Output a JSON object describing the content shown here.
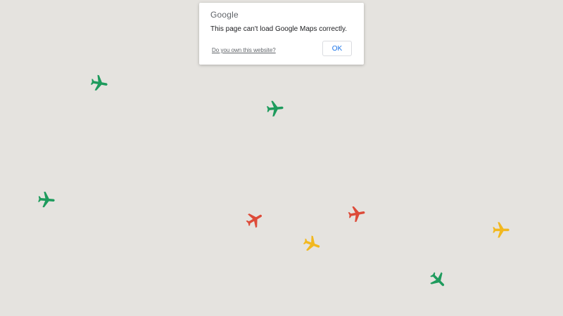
{
  "dialog": {
    "logo_text": "Google",
    "message": "This page can't load Google Maps correctly.",
    "own_link": "Do you own this website?",
    "ok_label": "OK"
  },
  "colors": {
    "map_background": "#e5e3df",
    "green": "#1e9b5d",
    "red": "#dd4b39",
    "yellow": "#f2b81f"
  },
  "markers": [
    {
      "icon": "airplane-icon",
      "color": "green"
    },
    {
      "icon": "airplane-icon",
      "color": "green"
    },
    {
      "icon": "airplane-icon",
      "color": "green"
    },
    {
      "icon": "airplane-icon",
      "color": "red"
    },
    {
      "icon": "airplane-icon",
      "color": "red"
    },
    {
      "icon": "airplane-icon",
      "color": "yellow"
    },
    {
      "icon": "airplane-icon",
      "color": "yellow"
    },
    {
      "icon": "airplane-icon",
      "color": "green"
    }
  ]
}
